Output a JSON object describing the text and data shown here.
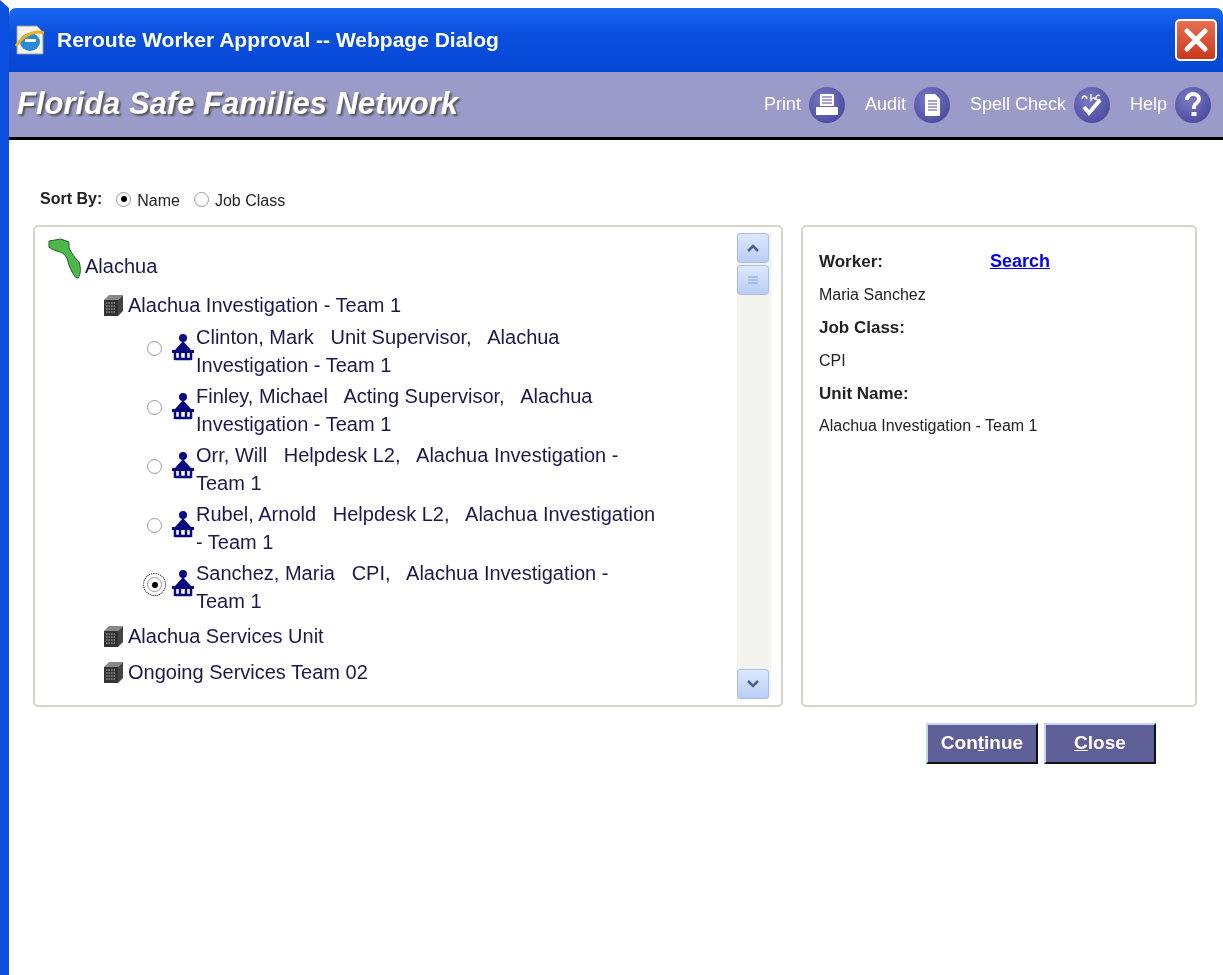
{
  "window": {
    "title": "Reroute Worker Approval -- Webpage Dialog"
  },
  "header": {
    "title": "Florida Safe Families Network",
    "actions": [
      {
        "label": "Print",
        "kind": "print"
      },
      {
        "label": "Audit",
        "kind": "audit"
      },
      {
        "label": "Spell Check",
        "kind": "spell"
      },
      {
        "label": "Help",
        "kind": "help"
      }
    ]
  },
  "sort_by": {
    "label": "Sort By:",
    "options": [
      {
        "label": "Name",
        "selected": true
      },
      {
        "label": "Job Class",
        "selected": false
      }
    ]
  },
  "tree": [
    {
      "kind": "region",
      "label": "Alachua",
      "children": [
        {
          "kind": "unit",
          "label": "Alachua Investigation - Team 1",
          "children": [
            {
              "kind": "worker",
              "label": "Clinton, Mark   Unit Supervisor,   Alachua Investigation - Team 1",
              "selected": false,
              "focused": false
            },
            {
              "kind": "worker",
              "label": "Finley, Michael   Acting Supervisor,   Alachua Investigation - Team 1",
              "selected": false,
              "focused": false
            },
            {
              "kind": "worker",
              "label": "Orr, Will   Helpdesk L2,   Alachua Investigation - Team 1",
              "selected": false,
              "focused": false
            },
            {
              "kind": "worker",
              "label": "Rubel, Arnold   Helpdesk L2,   Alachua Investigation - Team 1",
              "selected": false,
              "focused": false
            },
            {
              "kind": "worker",
              "label": "Sanchez, Maria   CPI,   Alachua Investigation - Team 1",
              "selected": true,
              "focused": true
            }
          ]
        },
        {
          "kind": "unit",
          "label": "Alachua Services Unit"
        },
        {
          "kind": "unit",
          "label": "Ongoing Services Team 02"
        }
      ]
    }
  ],
  "details": {
    "search_link": "Search",
    "fields": [
      {
        "label": "Worker:",
        "value": "Maria Sanchez"
      },
      {
        "label": "Job Class:",
        "value": "CPI"
      },
      {
        "label": "Unit Name:",
        "value": "Alachua Investigation - Team 1"
      }
    ]
  },
  "buttons": [
    {
      "before": "Con",
      "key": "t",
      "after": "inue"
    },
    {
      "key": "C",
      "after": "lose"
    }
  ]
}
